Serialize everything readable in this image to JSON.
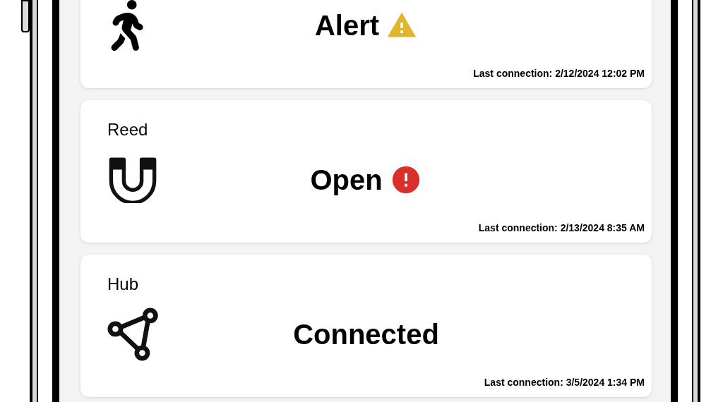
{
  "devices": [
    {
      "kind": "motion",
      "status": {
        "text": "Alert",
        "kind": "warning"
      },
      "last_connection": "Last connection: 2/12/2024 12:02 PM"
    },
    {
      "label": "Reed",
      "kind": "reed",
      "status": {
        "text": "Open",
        "kind": "error"
      },
      "last_connection": "Last connection: 2/13/2024 8:35 AM"
    },
    {
      "label": "Hub",
      "kind": "hub",
      "status": {
        "text": "Connected",
        "kind": "ok"
      },
      "last_connection": "Last connection: 3/5/2024 1:34 PM"
    }
  ]
}
